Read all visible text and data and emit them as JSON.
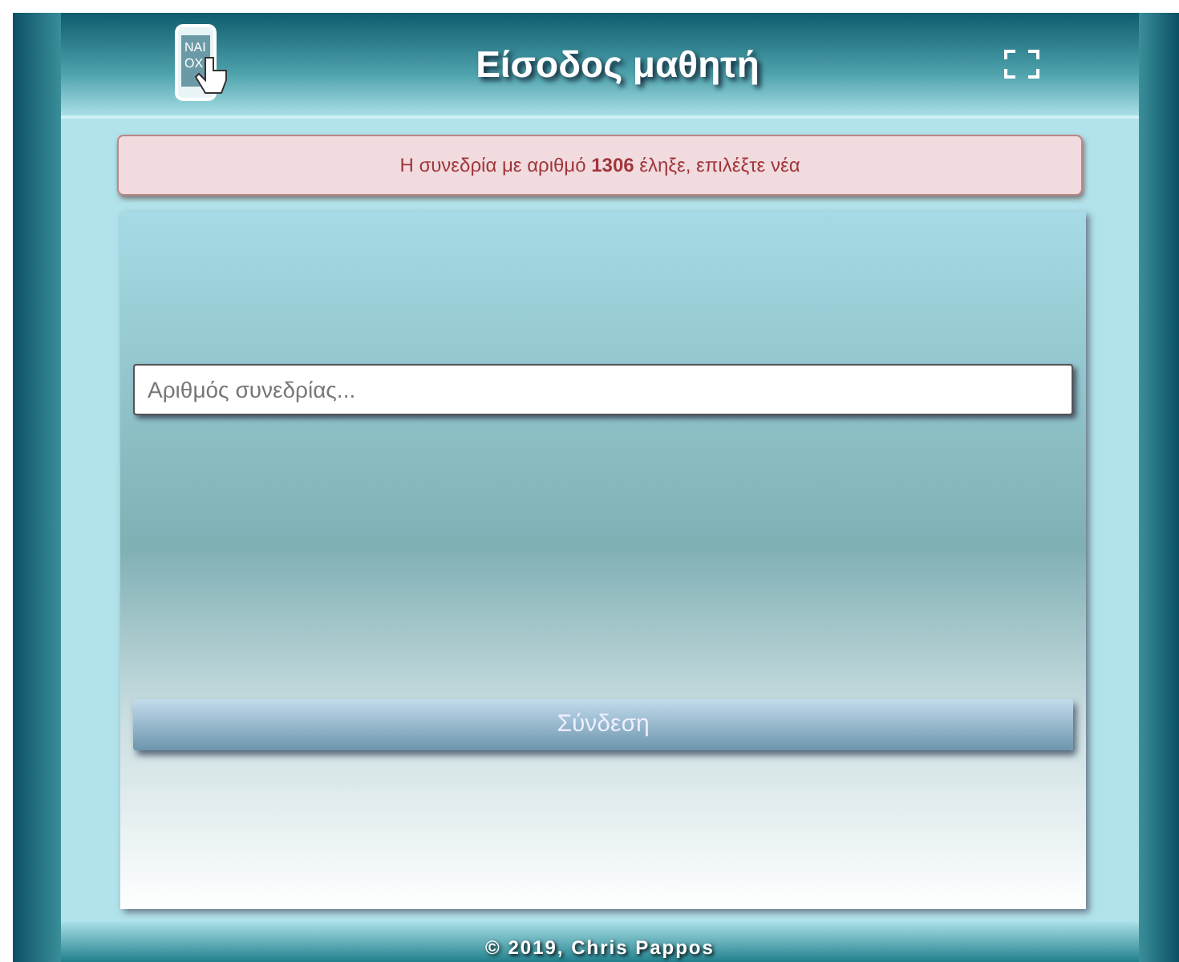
{
  "header": {
    "logo_text": [
      "NAI",
      "OX"
    ],
    "title": "Είσοδος μαθητή"
  },
  "alert": {
    "message": "Η συνεδρία με αριθμό **1306** έληξε, επιλέξτε νέα"
  },
  "form": {
    "session_field": {
      "placeholder": "Αριθμός συνεδρίας..."
    },
    "submit_button": "Σύνδεση"
  },
  "footer": {
    "text": "© 2019, Chris Pappos"
  }
}
